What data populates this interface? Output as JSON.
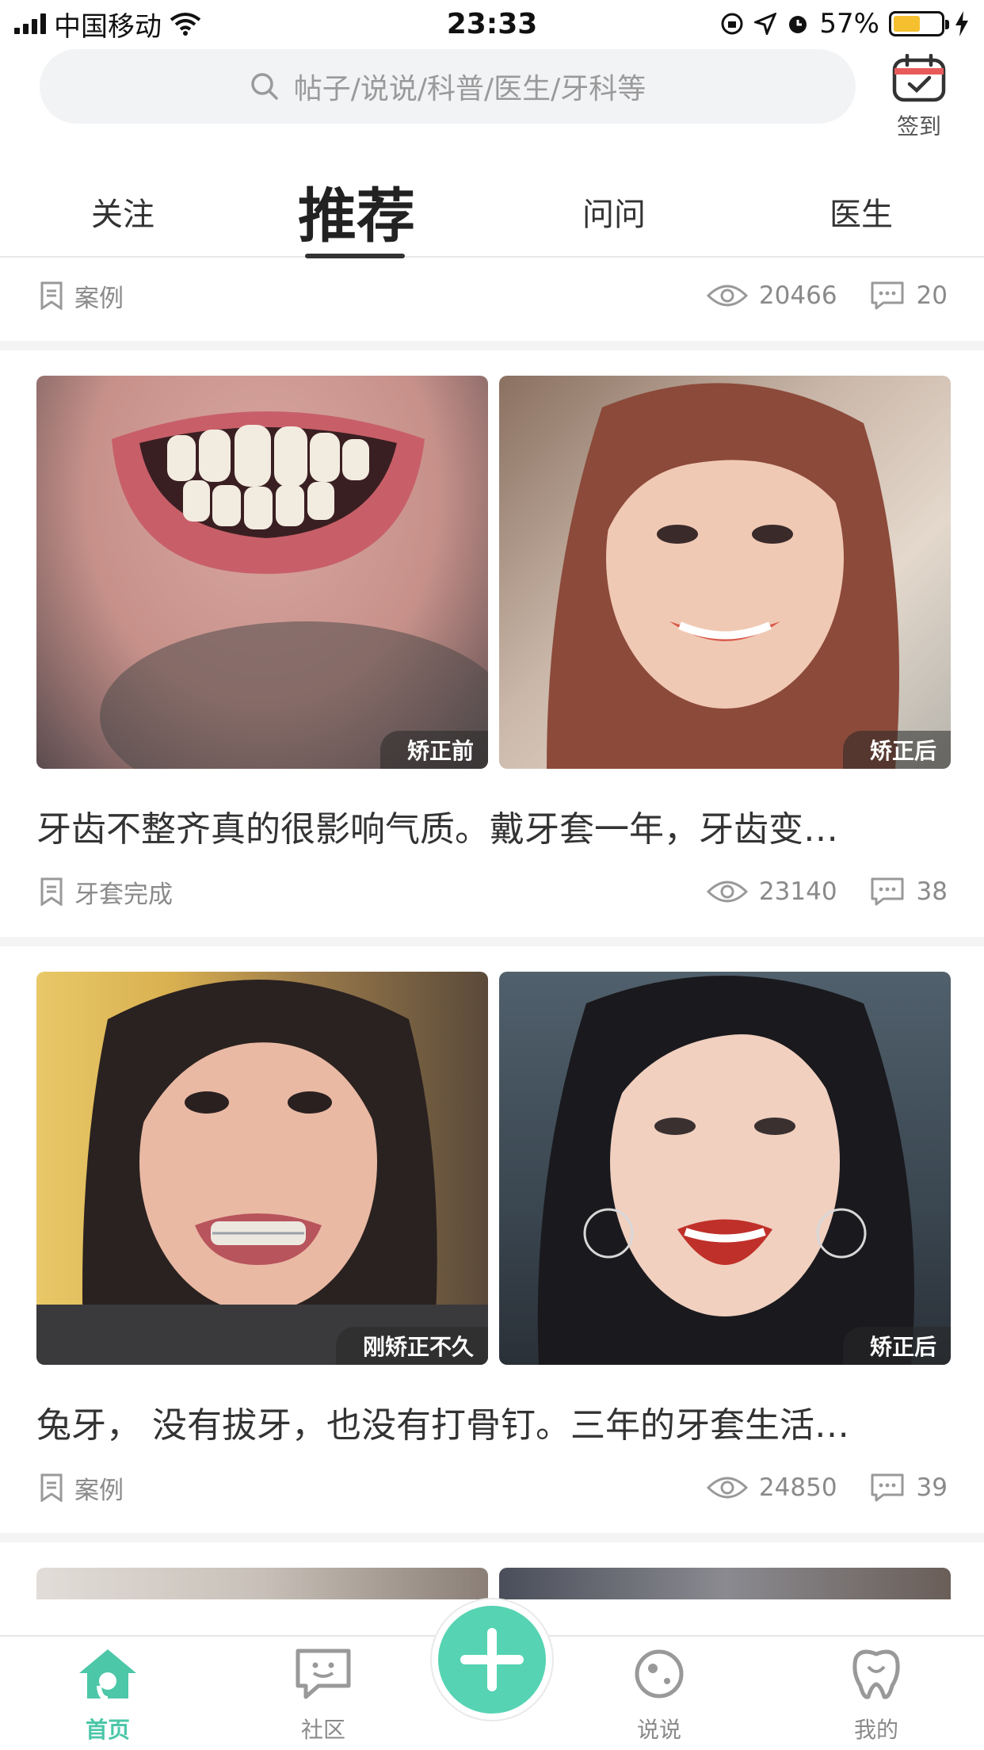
{
  "status_bar": {
    "carrier": "中国移动",
    "time": "23:33",
    "battery": "57%",
    "battery_level": 0.57
  },
  "search": {
    "placeholder": "帖子/说说/科普/医生/牙科等"
  },
  "checkin": {
    "label": "签到"
  },
  "tabs": [
    {
      "label": "关注",
      "active": false
    },
    {
      "label": "推荐",
      "active": true
    },
    {
      "label": "问问",
      "active": false
    },
    {
      "label": "医生",
      "active": false
    }
  ],
  "feed": {
    "top_partial": {
      "tag": "案例",
      "views": "20466",
      "comments": "20"
    },
    "posts": [
      {
        "left_label": "矫正前",
        "right_label": "矫正后",
        "title": "牙齿不整齐真的很影响气质。戴牙套一年，牙齿变…",
        "tag": "牙套完成",
        "views": "23140",
        "comments": "38"
      },
      {
        "left_label": "刚矫正不久",
        "right_label": "矫正后",
        "title": "兔牙， 没有拔牙，也没有打骨钉。三年的牙套生活…",
        "tag": "案例",
        "views": "24850",
        "comments": "39"
      }
    ]
  },
  "bottom_nav": [
    {
      "label": "首页",
      "icon": "home-icon",
      "active": true
    },
    {
      "label": "社区",
      "icon": "chat-icon",
      "active": false
    },
    {
      "label": "说说",
      "icon": "face-icon",
      "active": false
    },
    {
      "label": "我的",
      "icon": "tooth-icon",
      "active": false
    }
  ],
  "colors": {
    "accent": "#4cc7a8",
    "fab": "#56d3b3",
    "battery": "#f5c030"
  }
}
